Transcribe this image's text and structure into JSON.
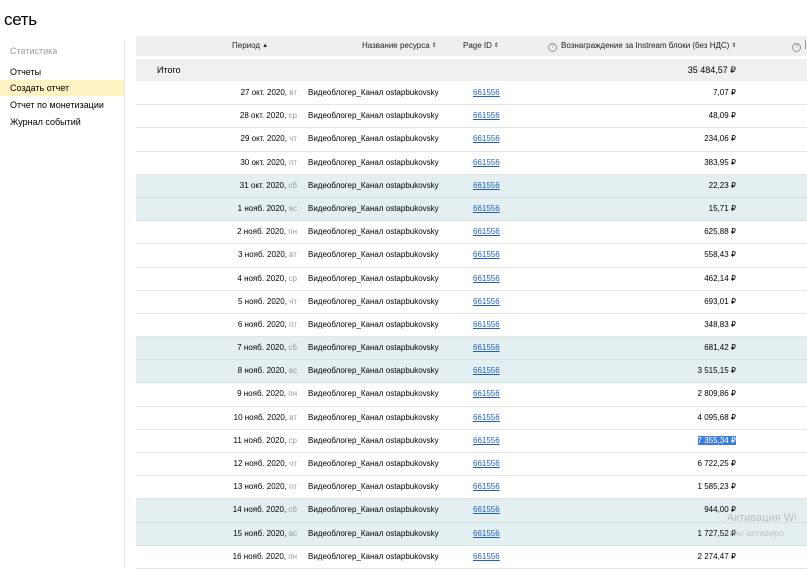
{
  "app": {
    "logo_text": "сеть"
  },
  "sidebar": {
    "heading": "Статистика",
    "items": [
      {
        "label": "Отчеты"
      },
      {
        "label": "Создать отчет"
      },
      {
        "label": "Отчет по монетизации"
      },
      {
        "label": "Журнал событий"
      }
    ]
  },
  "table": {
    "headers": {
      "period": "Период",
      "resource": "Название ресурса",
      "page_id": "Page ID",
      "reward": "Вознаграждение за Instream блоки (без НДС)"
    },
    "total_label": "Итого",
    "total_value": "35 484,57 ₽",
    "rows": [
      {
        "date": "27 окт. 2020,",
        "dow": "вт",
        "name": "Видеоблогер_Канал ostapbukovsky",
        "page_id": "661556",
        "amount": "7,07 ₽"
      },
      {
        "date": "28 окт. 2020,",
        "dow": "ср",
        "name": "Видеоблогер_Канал ostapbukovsky",
        "page_id": "661556",
        "amount": "48,09 ₽"
      },
      {
        "date": "29 окт. 2020,",
        "dow": "чт",
        "name": "Видеоблогер_Канал ostapbukovsky",
        "page_id": "661556",
        "amount": "234,06 ₽"
      },
      {
        "date": "30 окт. 2020,",
        "dow": "пт",
        "name": "Видеоблогер_Канал ostapbukovsky",
        "page_id": "661556",
        "amount": "383,95 ₽"
      },
      {
        "date": "31 окт. 2020,",
        "dow": "сб",
        "name": "Видеоблогер_Канал ostapbukovsky",
        "page_id": "661556",
        "amount": "22,23 ₽"
      },
      {
        "date": "1 нояб. 2020,",
        "dow": "вс",
        "name": "Видеоблогер_Канал ostapbukovsky",
        "page_id": "661556",
        "amount": "15,71 ₽"
      },
      {
        "date": "2 нояб. 2020,",
        "dow": "пн",
        "name": "Видеоблогер_Канал ostapbukovsky",
        "page_id": "661556",
        "amount": "625,88 ₽"
      },
      {
        "date": "3 нояб. 2020,",
        "dow": "вт",
        "name": "Видеоблогер_Канал ostapbukovsky",
        "page_id": "661556",
        "amount": "558,43 ₽"
      },
      {
        "date": "4 нояб. 2020,",
        "dow": "ср",
        "name": "Видеоблогер_Канал ostapbukovsky",
        "page_id": "661556",
        "amount": "462,14 ₽"
      },
      {
        "date": "5 нояб. 2020,",
        "dow": "чт",
        "name": "Видеоблогер_Канал ostapbukovsky",
        "page_id": "661556",
        "amount": "693,01 ₽"
      },
      {
        "date": "6 нояб. 2020,",
        "dow": "пт",
        "name": "Видеоблогер_Канал ostapbukovsky",
        "page_id": "661556",
        "amount": "348,83 ₽"
      },
      {
        "date": "7 нояб. 2020,",
        "dow": "сб",
        "name": "Видеоблогер_Канал ostapbukovsky",
        "page_id": "661556",
        "amount": "681,42 ₽"
      },
      {
        "date": "8 нояб. 2020,",
        "dow": "вс",
        "name": "Видеоблогер_Канал ostapbukovsky",
        "page_id": "661556",
        "amount": "3 515,15 ₽"
      },
      {
        "date": "9 нояб. 2020,",
        "dow": "пн",
        "name": "Видеоблогер_Канал ostapbukovsky",
        "page_id": "661556",
        "amount": "2 809,86 ₽"
      },
      {
        "date": "10 нояб. 2020,",
        "dow": "вт",
        "name": "Видеоблогер_Канал ostapbukovsky",
        "page_id": "661556",
        "amount": "4 095,68 ₽"
      },
      {
        "date": "11 нояб. 2020,",
        "dow": "ср",
        "name": "Видеоблогер_Канал ostapbukovsky",
        "page_id": "661556",
        "amount": "7 355,34 ₽"
      },
      {
        "date": "12 нояб. 2020,",
        "dow": "чт",
        "name": "Видеоблогер_Канал ostapbukovsky",
        "page_id": "661556",
        "amount": "6 722,25 ₽"
      },
      {
        "date": "13 нояб. 2020,",
        "dow": "пт",
        "name": "Видеоблогер_Канал ostapbukovsky",
        "page_id": "661556",
        "amount": "1 585,23 ₽"
      },
      {
        "date": "14 нояб. 2020,",
        "dow": "сб",
        "name": "Видеоблогер_Канал ostapbukovsky",
        "page_id": "661556",
        "amount": "944,00 ₽"
      },
      {
        "date": "15 нояб. 2020,",
        "dow": "вс",
        "name": "Видеоблогер_Канал ostapbukovsky",
        "page_id": "661556",
        "amount": "1 727,52 ₽"
      },
      {
        "date": "16 нояб. 2020,",
        "dow": "пн",
        "name": "Видеоблогер_Канал ostapbukovsky",
        "page_id": "661556",
        "amount": "2 274,47 ₽"
      }
    ]
  },
  "watermark": {
    "line1": "Активация Wi",
    "line2": "обы активиро"
  }
}
